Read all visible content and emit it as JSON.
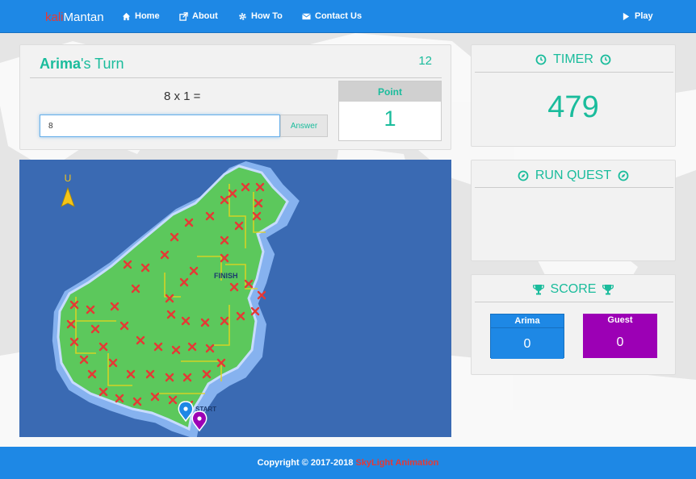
{
  "navbar": {
    "brand_prefix": "kali",
    "brand_suffix": "Mantan",
    "items": [
      {
        "label": "Home",
        "icon": "home-icon"
      },
      {
        "label": "About",
        "icon": "share-icon"
      },
      {
        "label": "How To",
        "icon": "gear-icon"
      },
      {
        "label": "Contact Us",
        "icon": "envelope-icon"
      }
    ],
    "play_label": "Play"
  },
  "turn": {
    "player": "Arima",
    "suffix": "'s Turn",
    "count": "12",
    "question": "8 x 1 =",
    "answer_value": "8",
    "answer_button": "Answer",
    "point_label": "Point",
    "point_value": "1"
  },
  "timer": {
    "title": "TIMER",
    "value": "479"
  },
  "run_quest": {
    "title": "RUN QUEST"
  },
  "score": {
    "title": "SCORE",
    "players": [
      {
        "name": "Arima",
        "value": "0",
        "color": "#1e88e5"
      },
      {
        "name": "Guest",
        "value": "0",
        "color": "#9c00b5"
      }
    ]
  },
  "map": {
    "north_label": "U",
    "finish_label": "FINISH",
    "start_label": "START"
  },
  "footer": {
    "copyright": "Copyright © 2017-2018",
    "company": "SkyLight  Animation"
  },
  "colors": {
    "primary": "#1e88e5",
    "accent": "#1abc9c",
    "guest": "#9c00b5",
    "brand_red": "#e53935"
  }
}
